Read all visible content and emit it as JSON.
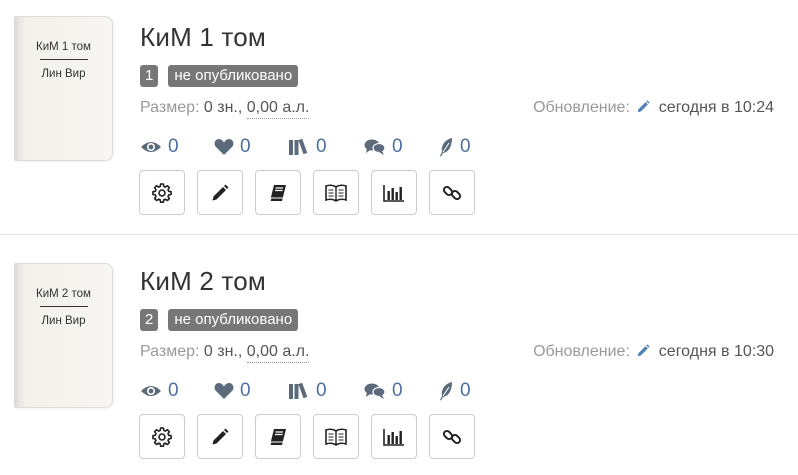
{
  "books": [
    {
      "cover_title": "КиМ 1 том",
      "cover_author": "Лин Вир",
      "title": "КиМ 1 том",
      "number": "1",
      "status": "не опубликовано",
      "size_label": "Размер:",
      "size_chars": "0 зн.,",
      "size_al": "0,00 а.л.",
      "updated_label": "Обновление:",
      "updated_value": "сегодня в 10:24",
      "stats": {
        "views": "0",
        "likes": "0",
        "libraries": "0",
        "comments": "0",
        "reviews": "0"
      }
    },
    {
      "cover_title": "КиМ 2 том",
      "cover_author": "Лин Вир",
      "title": "КиМ 2 том",
      "number": "2",
      "status": "не опубликовано",
      "size_label": "Размер:",
      "size_chars": "0 зн.,",
      "size_al": "0,00 а.л.",
      "updated_label": "Обновление:",
      "updated_value": "сегодня в 10:30",
      "stats": {
        "views": "0",
        "likes": "0",
        "libraries": "0",
        "comments": "0",
        "reviews": "0"
      }
    }
  ],
  "icons": {
    "stats": [
      "eye-icon",
      "heart-icon",
      "library-icon",
      "comments-icon",
      "feather-icon"
    ],
    "actions": [
      "gear-icon",
      "pencil-icon",
      "book-icon",
      "open-book-icon",
      "bar-chart-icon",
      "link-icon"
    ],
    "updated": "pencil-icon"
  },
  "colors": {
    "accent": "#4d6fa0",
    "badge": "#777777",
    "muted_text": "#999999",
    "icon": "#5b6b7c"
  }
}
